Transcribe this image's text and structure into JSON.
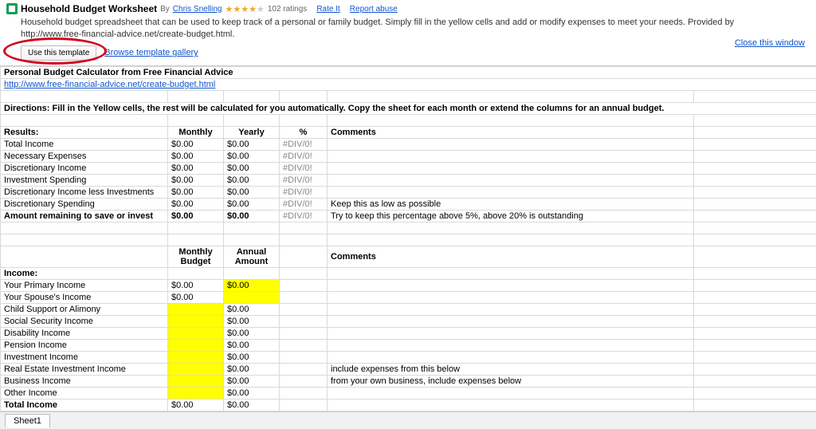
{
  "header": {
    "title": "Household Budget Worksheet",
    "by_label": "By",
    "author": "Chris Snelling",
    "ratings_count": "102 ratings",
    "rate_it": "Rate It",
    "report_abuse": "Report abuse",
    "description": "Household budget spreadsheet that can be used to keep track of a personal or family budget. Simply fill in the yellow cells and add or modify expenses to meet your needs. Provided by http://www.free-financial-advice.net/create-budget.html.",
    "use_template": "Use this template",
    "browse_gallery": "Browse template gallery",
    "close_window": "Close this window"
  },
  "sheet": {
    "title": "Personal Budget Calculator from Free Financial Advice",
    "source_link": "http://www.free-financial-advice.net/create-budget.html",
    "directions": "Directions: Fill in the Yellow cells, the rest will be calculated for you automatically. Copy the sheet for each month or extend the columns for an annual budget.",
    "results": {
      "heading": "Results:",
      "cols": {
        "monthly": "Monthly",
        "yearly": "Yearly",
        "percent": "%",
        "comments": "Comments"
      },
      "rows": [
        {
          "label": "Total Income",
          "m": "$0.00",
          "y": "$0.00",
          "p": "#DIV/0!",
          "c": ""
        },
        {
          "label": "Necessary Expenses",
          "m": "$0.00",
          "y": "$0.00",
          "p": "#DIV/0!",
          "c": ""
        },
        {
          "label": "Discretionary Income",
          "m": "$0.00",
          "y": "$0.00",
          "p": "#DIV/0!",
          "c": ""
        },
        {
          "label": "Investment Spending",
          "m": "$0.00",
          "y": "$0.00",
          "p": "#DIV/0!",
          "c": ""
        },
        {
          "label": "Discretionary Income less Investments",
          "m": "$0.00",
          "y": "$0.00",
          "p": "#DIV/0!",
          "c": ""
        },
        {
          "label": "Discretionary Spending",
          "m": "$0.00",
          "y": "$0.00",
          "p": "#DIV/0!",
          "c": "Keep this as low as possible"
        },
        {
          "label": "Amount remaining to save or invest",
          "m": "$0.00",
          "y": "$0.00",
          "p": "#DIV/0!",
          "c": "Try to keep this percentage above 5%, above 20% is outstanding"
        }
      ]
    },
    "income": {
      "head_budget": "Monthly Budget",
      "head_amount": "Annual Amount",
      "head_comments": "Comments",
      "heading": "Income:",
      "rows": [
        {
          "label": "Your Primary Income",
          "m": "$0.00",
          "a": "$0.00",
          "c": "",
          "my": false,
          "ay": true
        },
        {
          "label": "Your Spouse's Income",
          "m": "$0.00",
          "a": "",
          "c": "",
          "my": false,
          "ay": true
        },
        {
          "label": "Child Support or Alimony",
          "m": "",
          "a": "$0.00",
          "c": "",
          "my": true,
          "ay": false
        },
        {
          "label": "Social Security Income",
          "m": "",
          "a": "$0.00",
          "c": "",
          "my": true,
          "ay": false
        },
        {
          "label": "Disability Income",
          "m": "",
          "a": "$0.00",
          "c": "",
          "my": true,
          "ay": false
        },
        {
          "label": "Pension Income",
          "m": "",
          "a": "$0.00",
          "c": "",
          "my": true,
          "ay": false
        },
        {
          "label": "Investment Income",
          "m": "",
          "a": "$0.00",
          "c": "",
          "my": true,
          "ay": false
        },
        {
          "label": "Real Estate Investment Income",
          "m": "",
          "a": "$0.00",
          "c": "include expenses from this below",
          "my": true,
          "ay": false
        },
        {
          "label": "Business Income",
          "m": "",
          "a": "$0.00",
          "c": "from your own business, include expenses below",
          "my": true,
          "ay": false
        },
        {
          "label": "Other Income",
          "m": "",
          "a": "$0.00",
          "c": "",
          "my": true,
          "ay": false
        }
      ],
      "total": {
        "label": "Total Income",
        "m": "$0.00",
        "a": "$0.00"
      }
    }
  },
  "tabs": {
    "sheet1": "Sheet1"
  }
}
